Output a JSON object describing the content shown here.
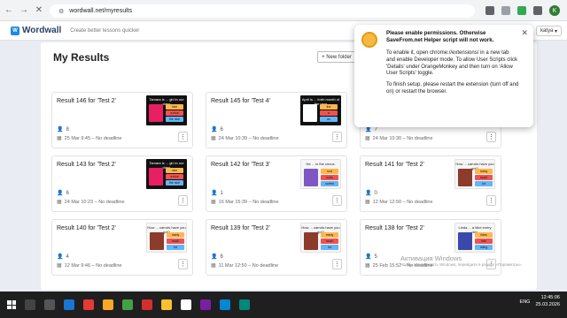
{
  "browser": {
    "url": "wordwall.net/myresults",
    "avatar_letter": "K"
  },
  "header": {
    "logo": "Wordwall",
    "tagline": "Create better lessons quicker",
    "user": "katya"
  },
  "page": {
    "title": "My Results",
    "new_folder_label": "+ New folder"
  },
  "cards": [
    {
      "title": "Result 146 for 'Test 2'",
      "count": "8",
      "date": "25 Mar 9:45 – No deadline",
      "thumb": "dark-girl",
      "thumb_caption": "Tamara is ... girl in our class"
    },
    {
      "title": "Result 145 for 'Test 4'",
      "count": "6",
      "date": "24 Mar 10:39 – No deadline",
      "thumb": "dark-calendar",
      "thumb_caption": "April is ... forth month of the year"
    },
    {
      "title": "",
      "count": "7",
      "date": "24 Mar 10:30 – No deadline",
      "thumb": "hidden"
    },
    {
      "title": "Result 143 for 'Test 2'",
      "count": "6",
      "date": "24 Mar 10:23 – No deadline",
      "thumb": "dark-girl",
      "thumb_caption": "Tamara is ... girl in our class"
    },
    {
      "title": "Result 142 for 'Test 3'",
      "count": "1",
      "date": "16 Mar 15:39 – No deadline",
      "thumb": "light-circus",
      "thumb_caption": "He ... in the circus."
    },
    {
      "title": "Result 141 for 'Test 2'",
      "count": "0",
      "date": "12 Mar 12:50 – No deadline",
      "thumb": "light-carrots",
      "thumb_caption": "How ... carrots have you got?"
    },
    {
      "title": "Result 140 for 'Test 2'",
      "count": "4",
      "date": "12 Mar 9:46 – No deadline",
      "thumb": "light-carrots",
      "thumb_caption": "How ... carrots have you got?"
    },
    {
      "title": "Result 139 for 'Test 2'",
      "count": "6",
      "date": "11 Mar 12:50 – No deadline",
      "thumb": "light-carrots",
      "thumb_caption": "How ... carrots have you got?"
    },
    {
      "title": "Result 138 for 'Test 2'",
      "count": "5",
      "date": "25 Feb 15:52 – No deadline",
      "thumb": "light-bike",
      "thumb_caption": "Linda ... a bike every day."
    }
  ],
  "thumb_options": {
    "girl": [
      "nice",
      "a nice",
      "the nice"
    ],
    "calendar": [
      "the",
      "a",
      "an"
    ],
    "circus": [
      "sort",
      "sorts",
      "sorted"
    ],
    "carrots": [
      "many",
      "much",
      "lot"
    ],
    "bike": [
      "rides",
      "ride",
      "riding"
    ]
  },
  "popup": {
    "title": "Please enable permissions. Otherwise SaveFrom.net Helper script will not work.",
    "para1": "To enable it, open chrome://extensions/ in a new tab and enable Developer mode. To allow User Scripts click 'Details' under OrangeMonkey and then turn on 'Allow User Scripts' toggle.",
    "para2": "To finish setup, please restart the extension (turn off and on) or restart the browser.",
    "close": "✕"
  },
  "watermark": {
    "title": "Активация Windows",
    "subtitle": "Чтобы активировать Windows, перейдите в раздел «Параметры»."
  },
  "taskbar": {
    "lang": "ENG",
    "time": "12:45:06",
    "date": "25.03.2026"
  },
  "colors": {
    "accent": "#1e88e5",
    "popup_icon": "#f5b942"
  }
}
